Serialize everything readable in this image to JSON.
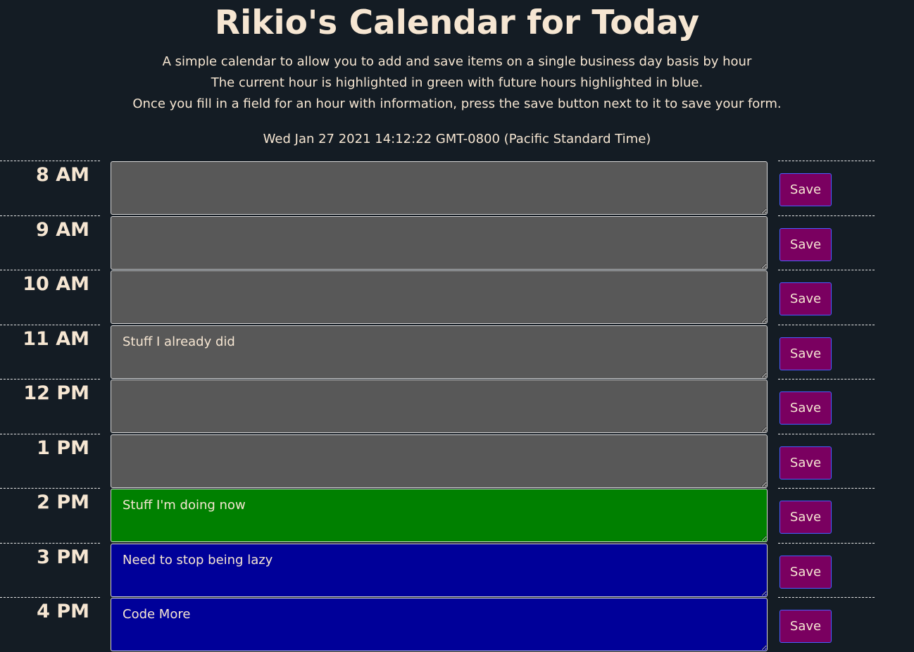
{
  "header": {
    "title": "Rikio's Calendar for Today",
    "description_lines": [
      "A simple calendar to allow you to add and save items on a single business day basis by hour",
      "The current hour is highlighted in green with future hours highlighted in blue.",
      "Once you fill in a field for an hour with information, press the save button next to it to save your form."
    ],
    "current_datetime": "Wed Jan 27 2021 14:12:22 GMT-0800 (Pacific Standard Time)"
  },
  "colors": {
    "past": "#585858",
    "present": "#008000",
    "future": "#000099",
    "save_button": "#7a0060",
    "background": "#141c24"
  },
  "hours": [
    {
      "label": "8 AM",
      "text": "",
      "state": "past",
      "save_label": "Save"
    },
    {
      "label": "9 AM",
      "text": "",
      "state": "past",
      "save_label": "Save"
    },
    {
      "label": "10 AM",
      "text": "",
      "state": "past",
      "save_label": "Save"
    },
    {
      "label": "11 AM",
      "text": "Stuff I already did",
      "state": "past",
      "save_label": "Save"
    },
    {
      "label": "12 PM",
      "text": "",
      "state": "past",
      "save_label": "Save"
    },
    {
      "label": "1 PM",
      "text": "",
      "state": "past",
      "save_label": "Save"
    },
    {
      "label": "2 PM",
      "text": "Stuff I'm doing now",
      "state": "present",
      "save_label": "Save"
    },
    {
      "label": "3 PM",
      "text": "Need to stop being lazy",
      "state": "future",
      "save_label": "Save"
    },
    {
      "label": "4 PM",
      "text": "Code More",
      "state": "future",
      "save_label": "Save"
    }
  ]
}
